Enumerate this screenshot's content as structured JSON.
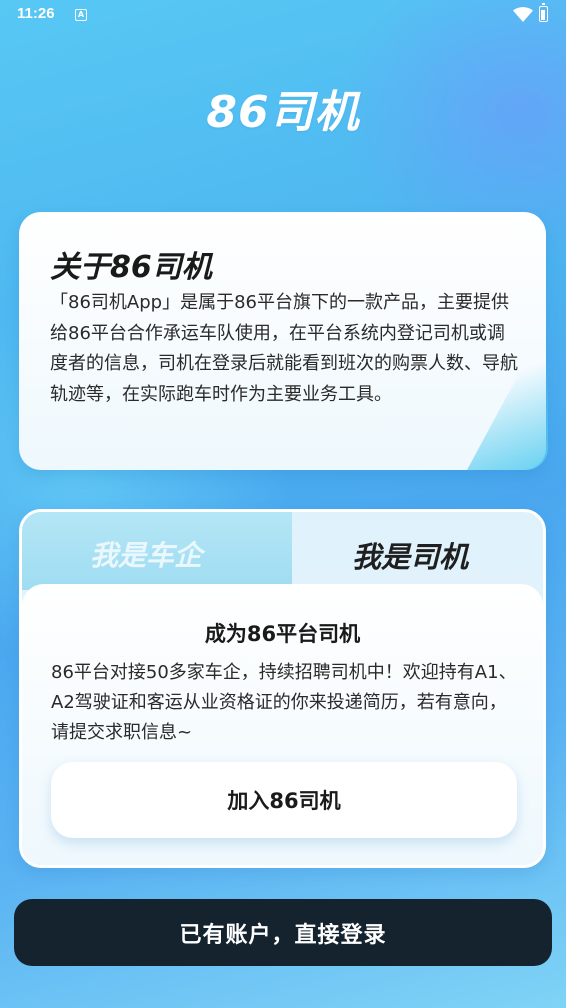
{
  "status_bar": {
    "time": "11:26",
    "notification_letter": "A",
    "icons": [
      "wifi-icon",
      "battery-icon"
    ]
  },
  "app": {
    "logo_text": "86司机"
  },
  "about": {
    "title": "关于86司机",
    "description": "「86司机App」是属于86平台旗下的一款产品，主要提供给86平台合作承运车队使用，在平台系统内登记司机或调度者的信息，司机在登录后就能看到班次的购票人数、导航轨迹等，在实际跑车时作为主要业务工具。"
  },
  "roles": {
    "tabs": [
      {
        "label": "我是车企",
        "selected": false
      },
      {
        "label": "我是司机",
        "selected": true
      }
    ],
    "heading": "成为86平台司机",
    "description": "86平台对接50多家车企，持续招聘司机中！欢迎持有A1、A2驾驶证和客运从业资格证的你来投递简历，若有意向，请提交求职信息~",
    "join_label": "加入86司机"
  },
  "login": {
    "label": "已有账户，直接登录"
  },
  "colors": {
    "background": "#4cb3ef",
    "login_button": "#14232e",
    "card": "#ffffff",
    "inactive_tab": "#a6dff3"
  }
}
